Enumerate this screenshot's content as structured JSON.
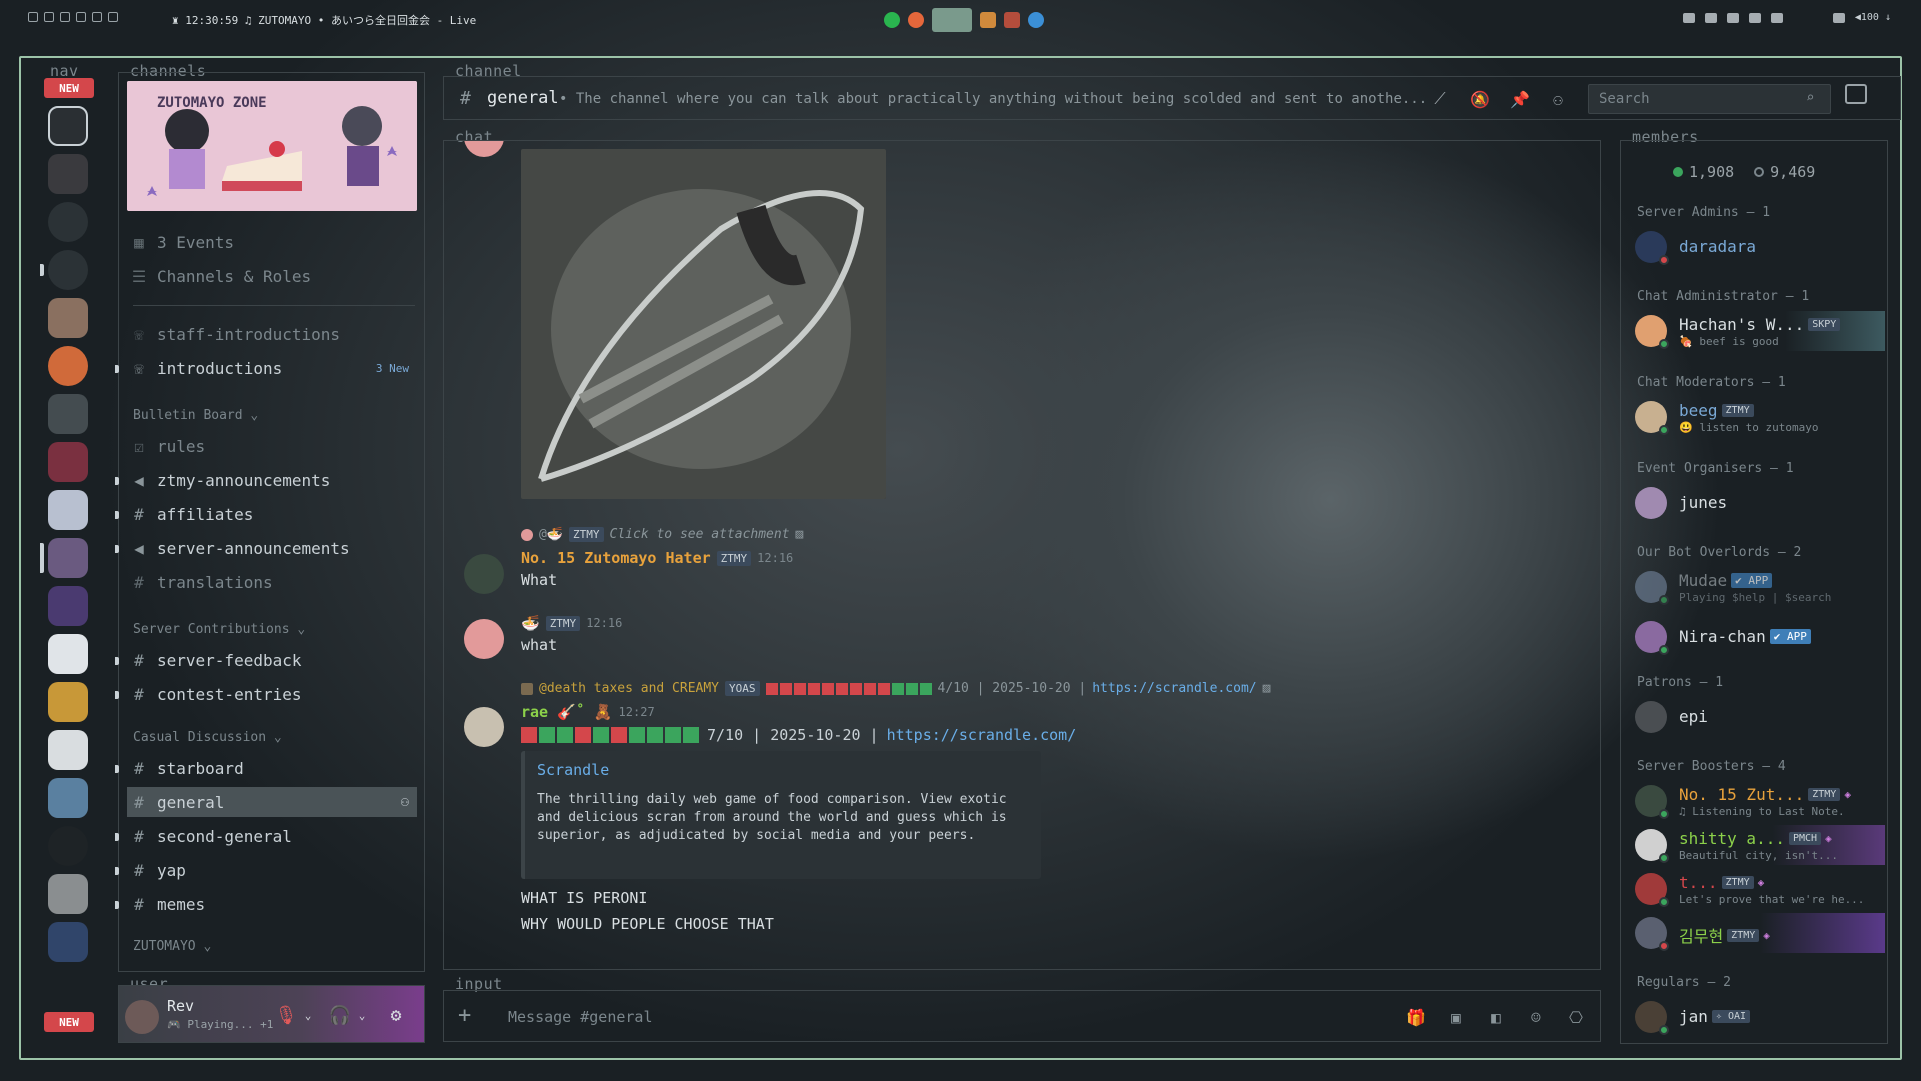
{
  "topbar": {
    "title": "♜ 12:30:59 ♫ ZUTOMAYO • あいつら全日回金会 - Live",
    "battery": "◀100 ↓"
  },
  "labels": {
    "nav": "nav",
    "channels": "channels",
    "channel": "channel",
    "chat": "chat",
    "members": "members",
    "user": "user",
    "input": "input"
  },
  "nav": {
    "new_badge_top": "NEW",
    "new_badge_bottom": "NEW"
  },
  "banner": {
    "title": "ZUTOMAYO ZONE"
  },
  "channels": {
    "events": "3 Events",
    "channels_roles": "Channels & Roles",
    "staff_introductions": "staff-introductions",
    "introductions": "introductions",
    "introductions_new": "3 New",
    "cat_bulletin": "Bulletin Board ⌄",
    "rules": "rules",
    "ztmy_announcements": "ztmy-announcements",
    "affiliates": "affiliates",
    "server_announcements": "server-announcements",
    "translations": "translations",
    "cat_contrib": "Server Contributions ⌄",
    "server_feedback": "server-feedback",
    "contest_entries": "contest-entries",
    "cat_casual": "Casual Discussion ⌄",
    "starboard": "starboard",
    "general": "general",
    "second_general": "second-general",
    "yap": "yap",
    "memes": "memes",
    "cat_zutomayo": "ZUTOMAYO ⌄"
  },
  "user": {
    "name": "Rev",
    "status": "🎮 Playing... +1"
  },
  "header": {
    "channel_name": "general",
    "topic": "• The channel where you can talk about practically anything without being scolded and sent to anothe...",
    "search_placeholder": "Search"
  },
  "messages": {
    "m1_reply": "@🍜",
    "m1_reply_tag": "ZTMY",
    "m1_reply_text": "Click to see attachment",
    "m1_author": "No. 15 Zutomayo Hater",
    "m1_author_tag": "ZTMY",
    "m1_time": "12:16",
    "m1_text": "What",
    "m2_author": "🍜",
    "m2_author_tag": "ZTMY",
    "m2_time": "12:16",
    "m2_text": "what",
    "m3_reply": "@death taxes and CREAMY",
    "m3_reply_tag": "YOAS",
    "m3_reply_score": "4/10 | 2025-10-20 |",
    "m3_reply_link": "https://scrandle.com/",
    "m3_author": "rae 🎸˚ 🧸",
    "m3_time": "12:27",
    "m3_score": "7/10 | 2025-10-20 |",
    "m3_link": "https://scrandle.com/",
    "embed_title": "Scrandle",
    "embed_desc": "The thrilling daily web game of food comparison. View exotic and delicious scran from around the world and guess which is superior, as adjudicated by social media and your peers.",
    "m3_text1": "WHAT IS PERONI",
    "m3_text2": "WHY WOULD PEOPLE CHOOSE THAT",
    "reply_score_bar": [
      "red",
      "red",
      "red",
      "red",
      "red",
      "red",
      "red",
      "red",
      "red",
      "green",
      "green",
      "green"
    ],
    "score_bar": [
      "red",
      "green",
      "green",
      "red",
      "green",
      "red",
      "green",
      "green",
      "green",
      "green"
    ]
  },
  "members": {
    "online": "1,908",
    "total": "9,469",
    "g_admins": "Server Admins — 1",
    "daradara": "daradara",
    "g_chat_admin": "Chat Administrator — 1",
    "hachan": "Hachan's W...",
    "hachan_tag": "SKPY",
    "hachan_act": "🍖 beef is good",
    "g_mods": "Chat Moderators — 1",
    "beeg": "beeg",
    "beeg_tag": "ZTMY",
    "beeg_act": "😃 listen to zutomayo",
    "g_events": "Event Organisers — 1",
    "junes": "junes",
    "g_bots": "Our Bot Overlords — 2",
    "mudae": "Mudae",
    "mudae_tag": "✔ APP",
    "mudae_act": "Playing $help | $search",
    "nira": "Nira-chan",
    "nira_tag": "✔ APP",
    "g_patrons": "Patrons — 1",
    "epi": "epi",
    "g_boosters": "Server Boosters — 4",
    "b1": "No. 15 Zut...",
    "b1_tag": "ZTMY",
    "b1_act": "♫ Listening to Last Note.",
    "b2": "shitty a...",
    "b2_tag": "PMCH",
    "b2_act": "Beautiful city, isn't...",
    "b3": "t...",
    "b3_tag": "ZTMY",
    "b3_act": "Let's prove that we're he...",
    "b4": "김무현",
    "b4_tag": "ZTMY",
    "g_regulars": "Regulars — 2",
    "jan": "jan",
    "jan_tag": "✧ OAI"
  },
  "input": {
    "placeholder": "Message #general"
  },
  "colors": {
    "accent": "#9cc3a8",
    "link": "#6aaee8",
    "online": "#3ba55d",
    "orange_name": "#e8a23c",
    "green_name": "#8cd14a",
    "red_score": "#d4474b",
    "green_score": "#3ba55d"
  }
}
